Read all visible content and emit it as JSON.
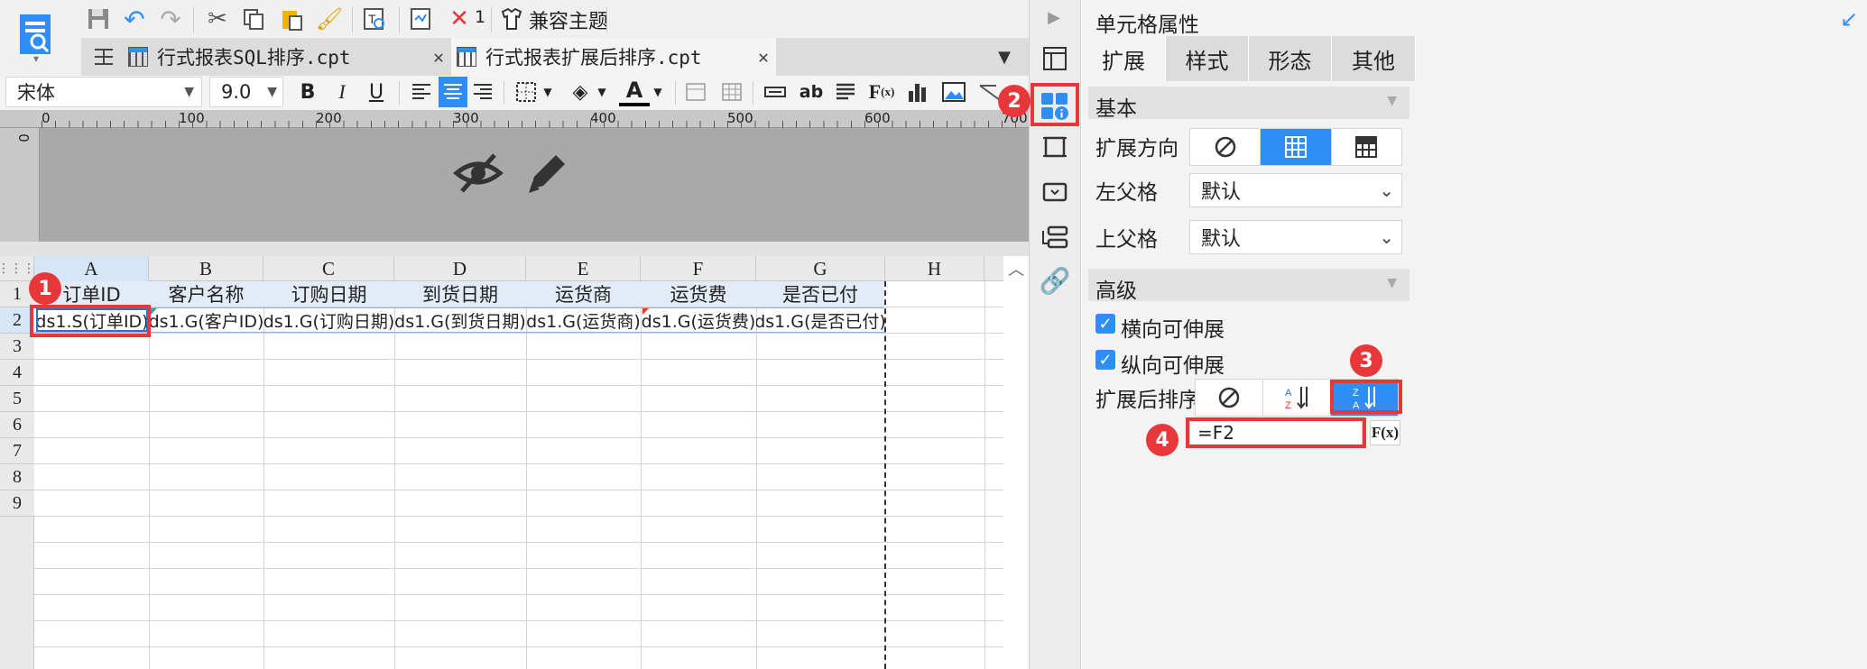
{
  "window": {
    "open_tab_count": "1"
  },
  "toolbar": {
    "theme_label": "兼容主题"
  },
  "tabs": [
    {
      "label": "行式报表SQL排序.cpt",
      "active": false
    },
    {
      "label": "行式报表扩展后排序.cpt",
      "active": true
    }
  ],
  "format": {
    "font": "宋体",
    "size": "9.0"
  },
  "ruler": {
    "ticks": [
      "0",
      "100",
      "200",
      "300",
      "400",
      "500",
      "600",
      "700"
    ],
    "vertical_tick": "0"
  },
  "grid": {
    "columns": [
      "A",
      "B",
      "C",
      "D",
      "E",
      "F",
      "G",
      "H"
    ],
    "rows": [
      "1",
      "2",
      "3",
      "4",
      "5",
      "6",
      "7",
      "8",
      "9"
    ],
    "header_row": [
      "订单ID",
      "客户名称",
      "订购日期",
      "到货日期",
      "运货商",
      "运货费",
      "是否已付"
    ],
    "data_row": [
      "ds1.S(订单ID)",
      "ds1.G(客户ID)",
      "ds1.G(订购日期)",
      "ds1.G(到货日期)",
      "ds1.G(运货商)",
      "ds1.G(运货费)",
      "ds1.G(是否已付)"
    ]
  },
  "panel": {
    "title": "单元格属性",
    "tabs": [
      "扩展",
      "样式",
      "形态",
      "其他"
    ],
    "basic_section": "基本",
    "expand_direction_label": "扩展方向",
    "left_parent_label": "左父格",
    "left_parent_value": "默认",
    "top_parent_label": "上父格",
    "top_parent_value": "默认",
    "advanced_section": "高级",
    "horizontal_expand_label": "横向可伸展",
    "vertical_expand_label": "纵向可伸展",
    "sort_label": "扩展后排序",
    "formula_value": "=F2",
    "formula_button": "F(x)"
  },
  "annotations": [
    "1",
    "2",
    "3",
    "4"
  ],
  "colors": {
    "accent": "#2f8ef4",
    "badge": "#e8373a",
    "ruler_bg": "#a6a6a6",
    "design_bg": "#a9a9a9"
  }
}
